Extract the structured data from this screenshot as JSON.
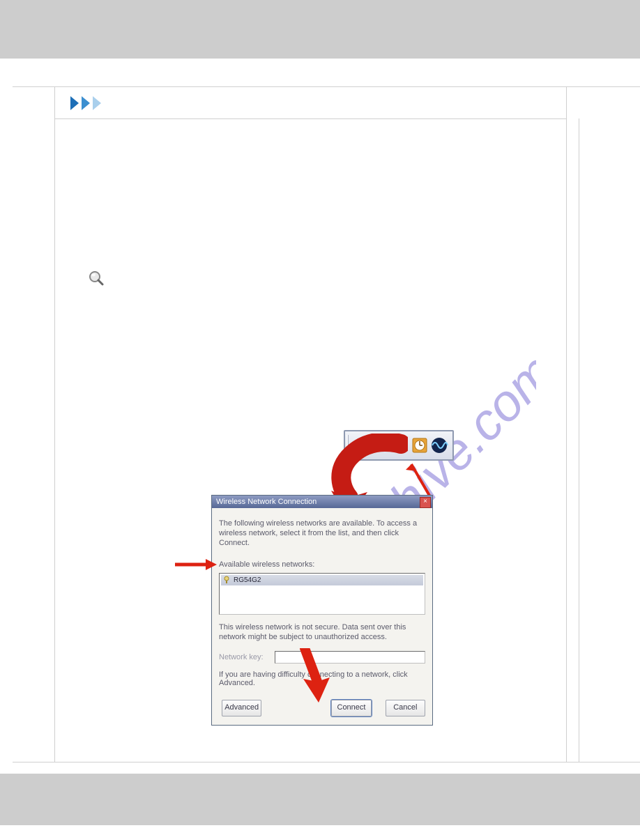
{
  "watermark_text": "manualshive.com",
  "tray": {
    "icons": [
      "back-icon",
      "network-icon",
      "wireless-icon",
      "clock-icon",
      "wave-icon"
    ]
  },
  "dialog": {
    "title": "Wireless Network Connection",
    "description": "The following wireless networks are available. To access a wireless network, select it from the list, and then click Connect.",
    "available_label": "Available wireless networks:",
    "list": [
      "RG54G2"
    ],
    "warning": "This wireless network is not secure. Data sent over this network might be subject to unauthorized access.",
    "network_key_label": "Network key:",
    "network_key_value": "",
    "difficulty_text": "If you are having difficulty connecting to a network, click Advanced.",
    "buttons": {
      "advanced": "Advanced",
      "connect": "Connect",
      "cancel": "Cancel"
    }
  }
}
